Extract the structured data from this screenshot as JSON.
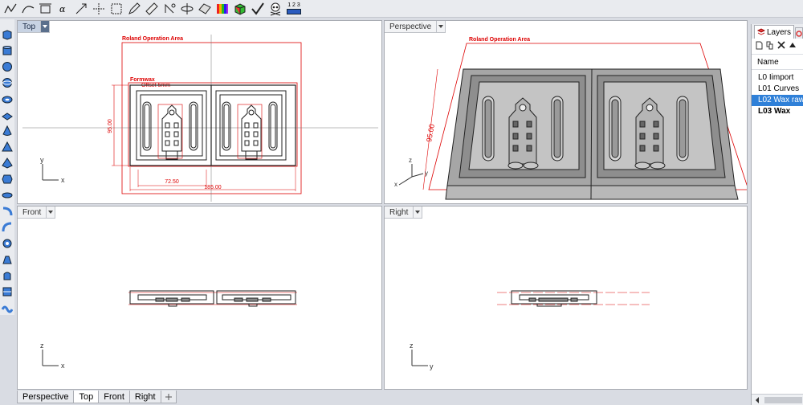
{
  "toolbar": {
    "icons": [
      "polyline-icon",
      "curve-icon",
      "dimension-icon",
      "angle-dimension-icon",
      "arrow-leader-icon",
      "point-icon",
      "linear-dimension-icon",
      "edit-icon",
      "ruler-icon",
      "rotate-dimension-icon",
      "bounding-box-icon",
      "curvature-icon",
      "split-icon",
      "tag-icon",
      "rainbow-analysis-icon",
      "color-box-icon",
      "check-icon",
      "skull-icon",
      "number-dimension-icon"
    ],
    "number_label": "1 2 3"
  },
  "left_toolbar": {
    "icons": [
      "box-icon",
      "cylinder-icon",
      "sphere-icon",
      "ellipsoid-icon",
      "torus-icon",
      "plane-icon",
      "cone-icon",
      "tetrahedron-icon",
      "pyramid-icon",
      "prism-icon",
      "tube-icon",
      "pipe-icon",
      "sweep-icon",
      "extrude-icon",
      "loft-icon",
      "surface-icon",
      "helix-icon",
      "wave-icon"
    ]
  },
  "viewports": {
    "top": {
      "title": "Top",
      "annotations": {
        "operation_area": "Roland Operation Area",
        "formwax": "Formwax",
        "offset": "Offset 5mm",
        "dim_height": "95.00",
        "dim_inner": "72.50",
        "dim_width": "185.00"
      },
      "axis": {
        "v": "y",
        "h": "x"
      }
    },
    "perspective": {
      "title": "Perspective",
      "annotations": {
        "operation_area": "Roland Operation Area",
        "dim_height": "95.00"
      },
      "axis": {
        "v": "z",
        "h": "x",
        "d": "y"
      }
    },
    "front": {
      "title": "Front",
      "axis": {
        "v": "z",
        "h": "x"
      }
    },
    "right": {
      "title": "Right",
      "axis": {
        "v": "z",
        "h": "y"
      }
    }
  },
  "bottom_tabs": [
    {
      "label": "Perspective",
      "active": false
    },
    {
      "label": "Top",
      "active": true
    },
    {
      "label": "Front",
      "active": false
    },
    {
      "label": "Right",
      "active": false
    }
  ],
  "layers_panel": {
    "tab_label": "Layers",
    "column_header": "Name",
    "layers": [
      {
        "name": "L0 Iimport",
        "selected": false,
        "current": false
      },
      {
        "name": "L01 Curves",
        "selected": false,
        "current": false
      },
      {
        "name": "L02 Wax raw",
        "selected": true,
        "current": false
      },
      {
        "name": "L03 Wax",
        "selected": false,
        "current": true
      }
    ]
  },
  "colors": {
    "annotation": "#dd0000",
    "selection": "#2f80d8",
    "active_tab": "#c8d3e3",
    "wax_surface": "#a6a6a6"
  }
}
